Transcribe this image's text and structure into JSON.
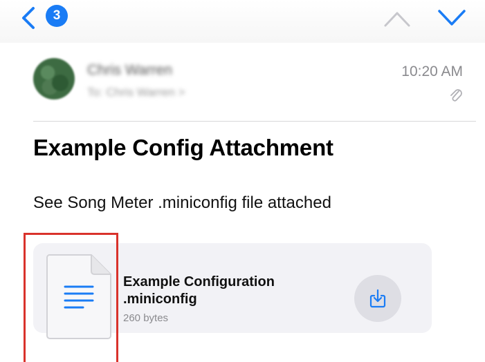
{
  "header": {
    "unread_count": "3",
    "icons": [
      "chevron-left-icon",
      "chevron-up-icon",
      "chevron-down-icon"
    ]
  },
  "message": {
    "sender": "Chris Warren",
    "recipient": "To: Chris Warren >",
    "time": "10:20 AM",
    "subject": "Example Config Attachment",
    "body": "See Song Meter .miniconfig file attached"
  },
  "attachment": {
    "name_line1": "Example Configuration",
    "name_line2": ".miniconfig",
    "size": "260 bytes"
  },
  "colors": {
    "accent": "#1a7cf5",
    "highlight": "#d9322b",
    "card": "#f2f2f6"
  }
}
